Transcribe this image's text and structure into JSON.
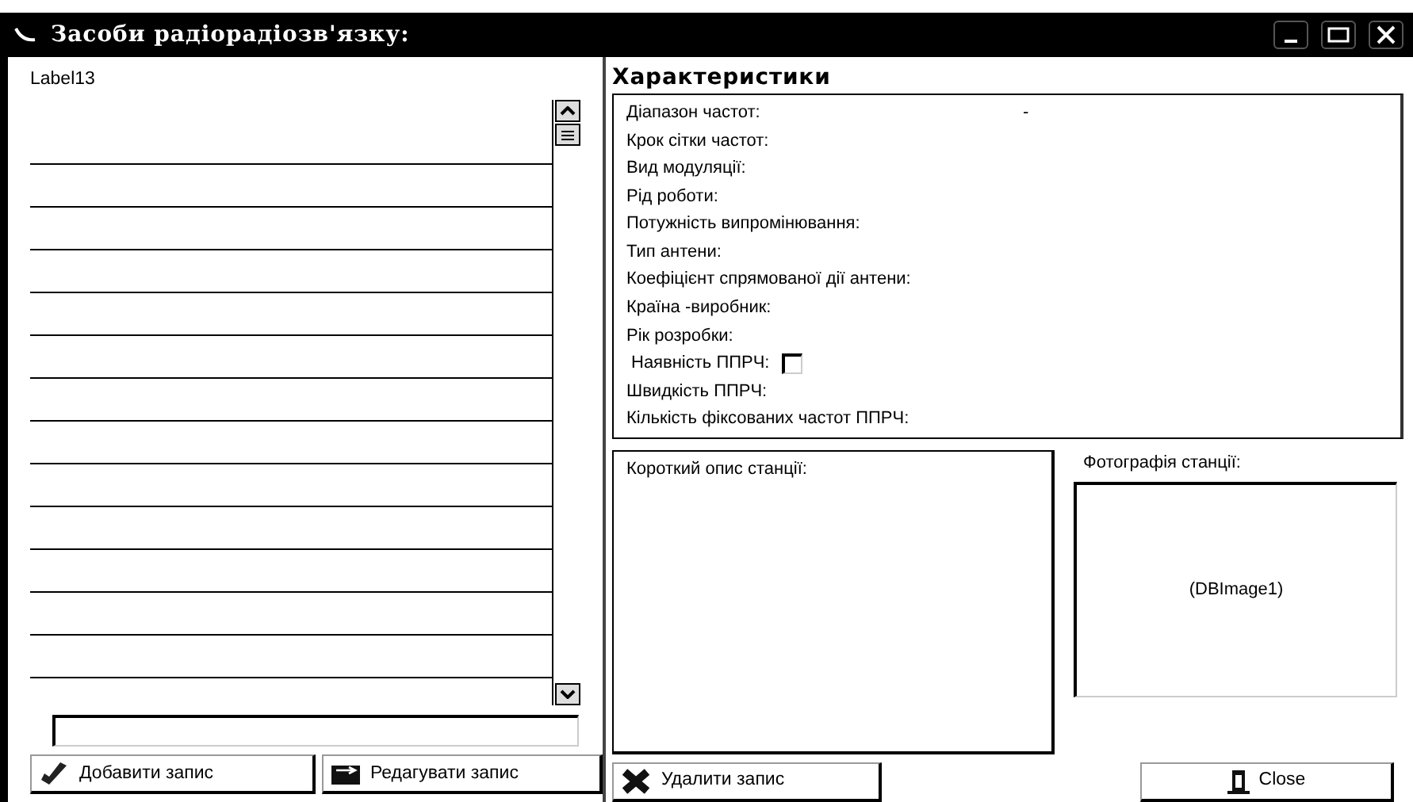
{
  "window": {
    "title": "Засоби радіорадіозв'язку:"
  },
  "list_panel": {
    "label": "Label13"
  },
  "characteristics": {
    "title": "Характеристики",
    "rows": [
      {
        "kind": "text",
        "label": "Діапазон частот:",
        "value": "-"
      },
      {
        "kind": "text",
        "label": "Крок сітки частот:"
      },
      {
        "kind": "text",
        "label": "Вид модуляції:"
      },
      {
        "kind": "text",
        "label": "Рід роботи:"
      },
      {
        "kind": "text",
        "label": "Потужність випромінювання:"
      },
      {
        "kind": "text",
        "label": "Тип антени:"
      },
      {
        "kind": "text",
        "label": "Коефіцієнт спрямованої дії антени:"
      },
      {
        "kind": "text",
        "label": "Країна -виробник:"
      },
      {
        "kind": "text",
        "label": "Рік розробки:"
      },
      {
        "kind": "checkbox",
        "label": "Наявність ППРЧ:",
        "checked": false
      },
      {
        "kind": "text",
        "label": "Швидкість ППРЧ:"
      },
      {
        "kind": "text",
        "label": "Кількість фіксованих частот ППРЧ:"
      }
    ]
  },
  "description": {
    "label": "Короткий опис станції:"
  },
  "photo": {
    "label": "Фотографія станції:",
    "caption": "(DBImage1)"
  },
  "buttons": [
    {
      "kind": "add",
      "label": "Добавити запис"
    },
    {
      "kind": "edit",
      "label": "Редагувати запис"
    },
    {
      "kind": "delete",
      "label": "Удалити запис"
    },
    {
      "kind": "close",
      "label": "Close"
    }
  ]
}
